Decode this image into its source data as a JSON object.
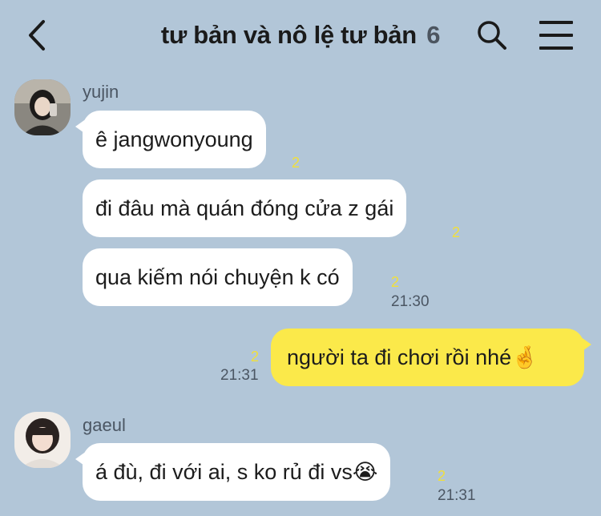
{
  "header": {
    "title": "tư bản và nô lệ tư bản",
    "member_count": "6",
    "back_icon": "chevron-left-icon",
    "search_icon": "search-icon",
    "menu_icon": "hamburger-menu-icon"
  },
  "messages": [
    {
      "sender": "yujin",
      "text": "ê jangwonyoung",
      "unread": "2",
      "time": ""
    },
    {
      "sender": "",
      "text": "đi đâu mà quán đóng cửa z gái",
      "unread": "2",
      "time": ""
    },
    {
      "sender": "",
      "text": "qua kiếm nói chuyện k có",
      "unread": "2",
      "time": "21:30"
    },
    {
      "sender": "me",
      "text": "người ta đi chơi rồi nhé🤞",
      "unread": "2",
      "time": "21:31"
    },
    {
      "sender": "gaeul",
      "text": "á đù, đi với ai, s ko rủ đi vs😭",
      "unread": "2",
      "time": "21:31"
    }
  ],
  "colors": {
    "background": "#b2c6d8",
    "incoming_bubble": "#ffffff",
    "outgoing_bubble": "#fbe94a",
    "unread_count": "#f1df3b"
  }
}
